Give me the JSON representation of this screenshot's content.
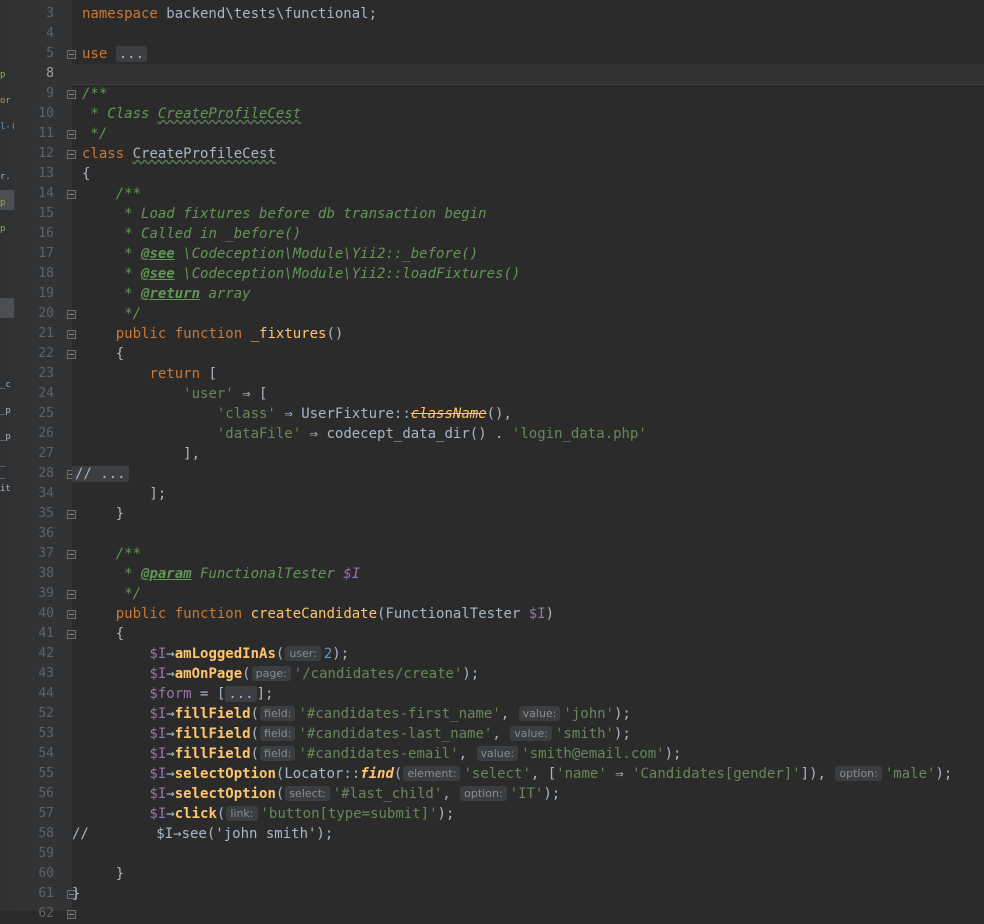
{
  "left_strip": {
    "fragments": [
      "p",
      "or",
      "l-(",
      "r.",
      "p",
      "p",
      "_c",
      "_p",
      "_p",
      "_",
      "_",
      "it"
    ]
  },
  "gutter": {
    "line_numbers": [
      "3",
      "4",
      "5",
      "8",
      "9",
      "10",
      "11",
      "12",
      "13",
      "14",
      "15",
      "16",
      "17",
      "18",
      "19",
      "20",
      "21",
      "22",
      "23",
      "24",
      "25",
      "26",
      "27",
      "28",
      "34",
      "35",
      "36",
      "37",
      "38",
      "39",
      "40",
      "41",
      "42",
      "43",
      "44",
      "52",
      "53",
      "54",
      "55",
      "56",
      "57",
      "58",
      "59",
      "60",
      "61",
      "62"
    ]
  },
  "code": {
    "namespace_kw": "namespace",
    "namespace_path": " backend\\tests\\functional;",
    "use_kw": "use",
    "use_fold": "...",
    "doc_open": "/**",
    "doc_class": " * Class CreateProfileCest",
    "doc_class_prefix": " * Class ",
    "doc_class_name": "CreateProfileCest",
    "doc_close": " */",
    "class_kw": "class",
    "class_name": "CreateProfileCest",
    "brace_open": "{",
    "brace_close": "}",
    "fix_doc_open": "/**",
    "fix_doc_1": "* Load fixtures before db transaction begin",
    "fix_doc_2": "* Called in _before()",
    "fix_doc_see1_tag": "@see",
    "fix_doc_see1": " \\Codeception\\Module\\Yii2::_before()",
    "fix_doc_see2_tag": "@see",
    "fix_doc_see2": " \\Codeception\\Module\\Yii2::loadFixtures()",
    "fix_doc_ret_tag": "@return",
    "fix_doc_ret": " array",
    "fix_doc_close": "*/",
    "public_kw": "public",
    "function_kw": "function",
    "fixtures_fn": "_fixtures",
    "return_kw": "return",
    "user_key": "'user'",
    "arrow": "⇒",
    "class_key": "'class'",
    "user_fixture": "UserFixture",
    "class_name_call": "className",
    "datafile_key": "'dataFile'",
    "codecept_fn": "codecept_data_dir",
    "login_data": "'login_data.php'",
    "comment_fold": "// ...",
    "param_doc_open": "/**",
    "param_tag": "@param",
    "param_type": " FunctionalTester ",
    "param_var": "$I",
    "param_doc_close": "*/",
    "create_fn": "createCandidate",
    "functional_tester": "FunctionalTester",
    "var_i": "$I",
    "var_form": "$form",
    "am_logged_in": "amLoggedInAs",
    "hint_user": "user:",
    "num_2": "2",
    "am_on_page": "amOnPage",
    "hint_page": "page:",
    "candidates_create": "'/candidates/create'",
    "form_fold": "...",
    "fill_field": "fillField",
    "hint_field": "field:",
    "hint_value": "value:",
    "first_name_sel": "'#candidates-first_name'",
    "john": "'john'",
    "last_name_sel": "'#candidates-last_name'",
    "smith": "'smith'",
    "email_sel": "'#candidates-email'",
    "smith_email": "'smith@email.com'",
    "select_option": "selectOption",
    "locator": "Locator",
    "find_fn": "find",
    "hint_element": "element:",
    "select_str": "'select'",
    "name_key": "'name'",
    "gender_str": "'Candidates[gender]'",
    "hint_option": "option:",
    "male": "'male'",
    "hint_select": "select:",
    "last_child": "'#last_child'",
    "it_str": "'IT'",
    "click_fn": "click",
    "hint_link": "link:",
    "submit_btn": "'button[type=submit]'",
    "commented_see": "//        $I→see('john smith');"
  },
  "colors": {
    "background": "#2b2b2b",
    "gutter": "#313335",
    "keyword": "#cc7832",
    "string": "#6a8759",
    "comment": "#629755",
    "variable": "#9876aa",
    "method": "#ffc66d",
    "number": "#6897bb"
  }
}
